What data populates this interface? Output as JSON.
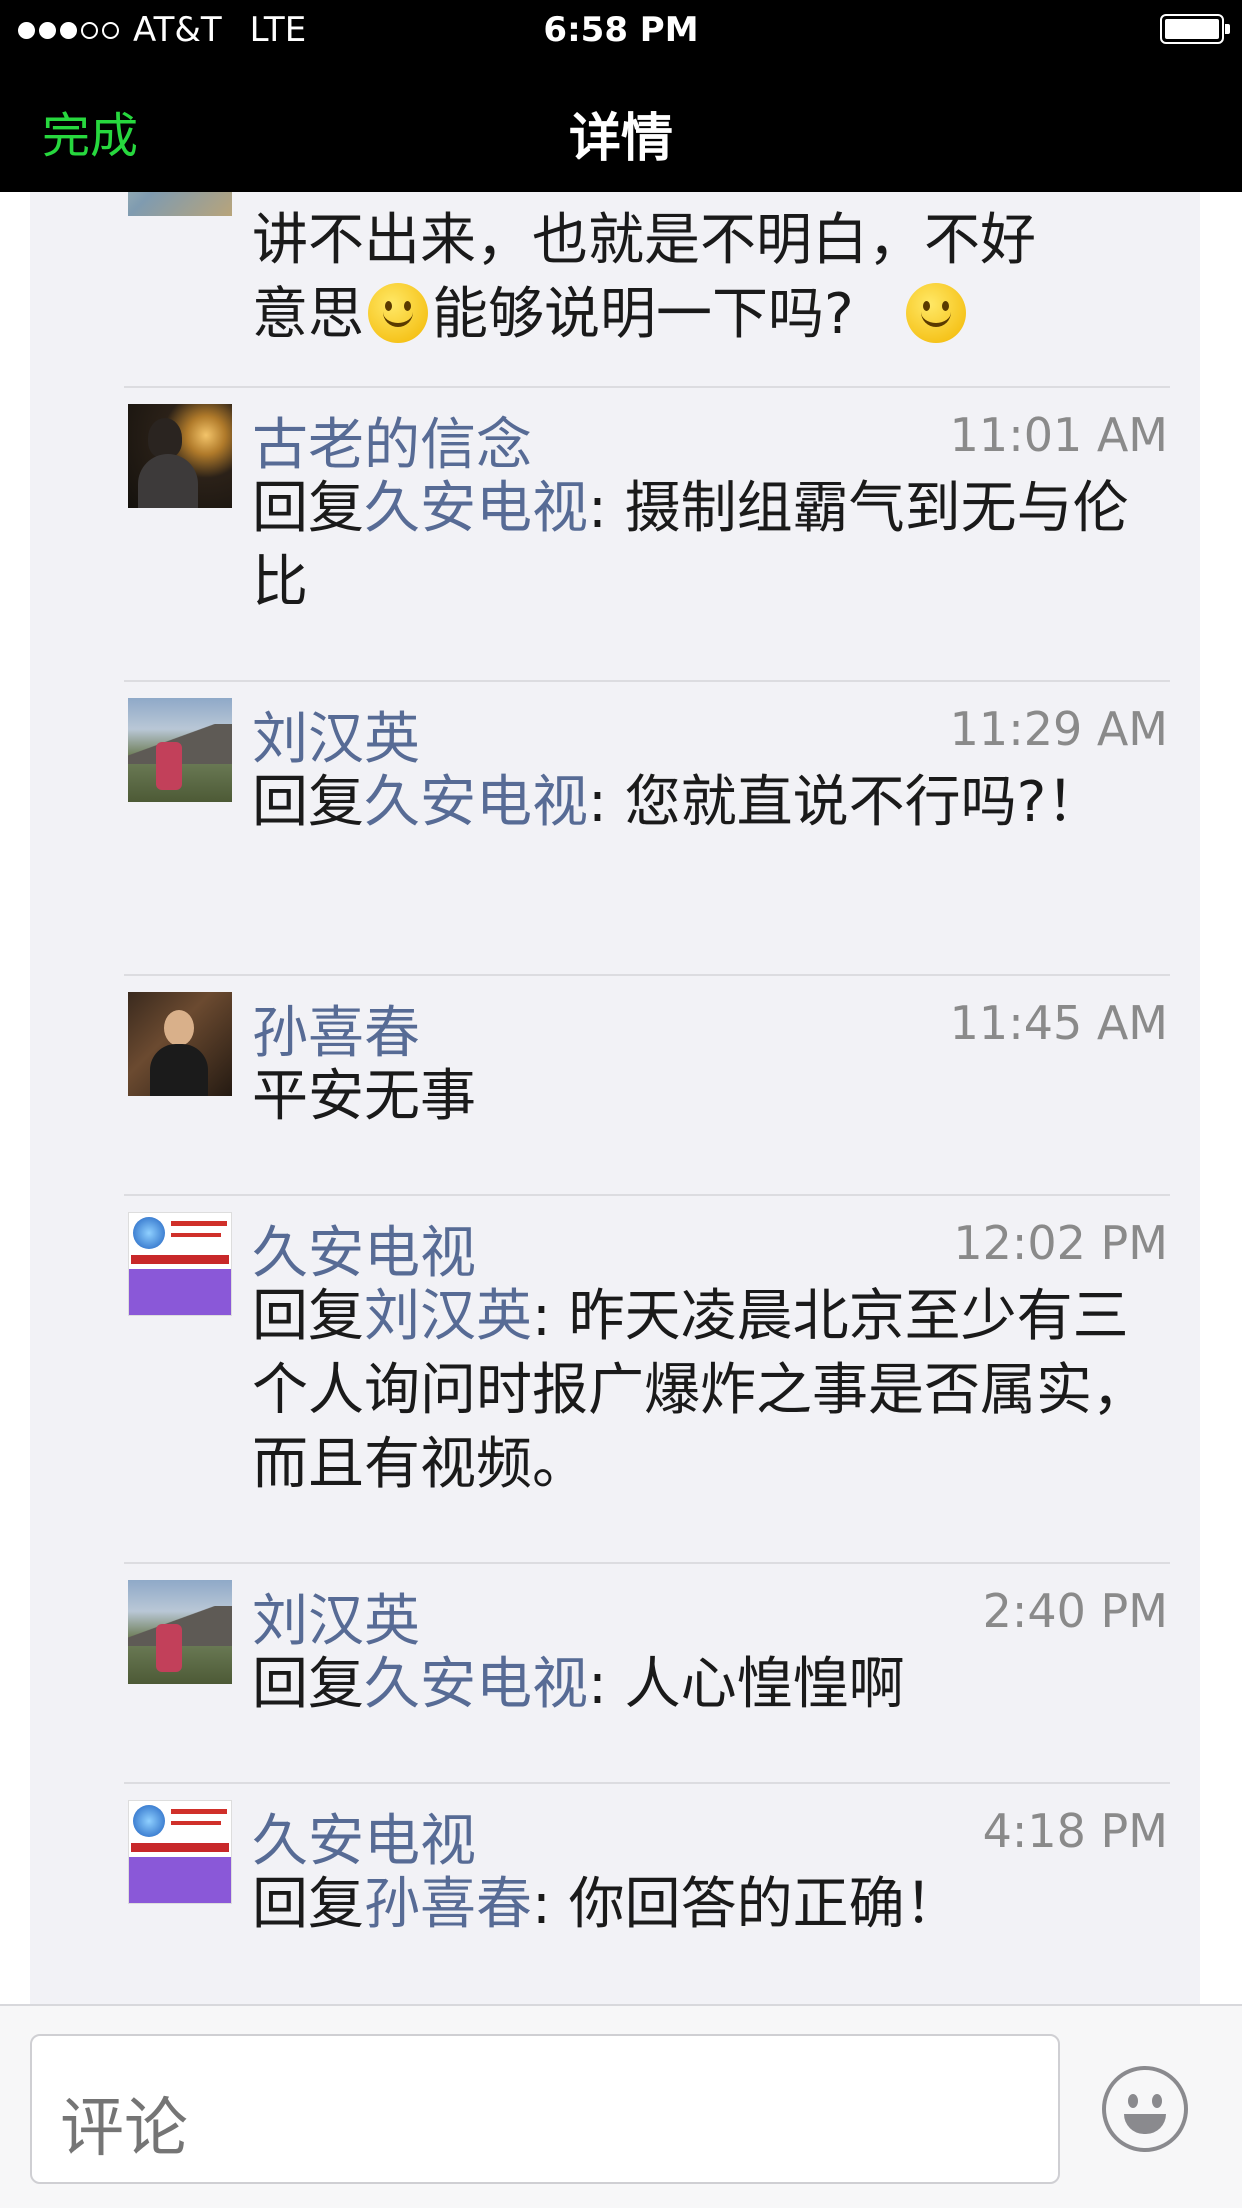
{
  "status_bar": {
    "signal_dots": [
      true,
      true,
      true,
      false,
      false
    ],
    "carrier": "AT&T",
    "network": "LTE",
    "time": "6:58 PM"
  },
  "nav": {
    "done_label": "完成",
    "title": "详情",
    "done_color": "#27d83e"
  },
  "partial_comment": {
    "text_line1": "讲不出来，也就是不明白，不好",
    "text_line2a": "意思",
    "text_line2b": "能够说明一下吗?"
  },
  "comments": [
    {
      "name": "古老的信念",
      "time": "11:01 AM",
      "reply_prefix": "回复",
      "reply_to": "久安电视",
      "text": ": 摄制组霸气到无与伦比",
      "avatar": "person-at-table-avatar"
    },
    {
      "name": "刘汉英",
      "time": "11:29 AM",
      "reply_prefix": "回复",
      "reply_to": "久安电视",
      "text": ": 您就直说不行吗?！",
      "avatar": "mountain-hiker-avatar"
    },
    {
      "name": "孙喜春",
      "time": "11:45 AM",
      "reply_prefix": "",
      "reply_to": "",
      "text": "平安无事",
      "avatar": "man-portrait-avatar"
    },
    {
      "name": "久安电视",
      "time": "12:02 PM",
      "reply_prefix": "回复",
      "reply_to": "刘汉英",
      "text": ": 昨天凌晨北京至少有三个人询问时报广爆炸之事是否属实，而且有视频。",
      "avatar": "company-logo-avatar"
    },
    {
      "name": "刘汉英",
      "time": "2:40 PM",
      "reply_prefix": "回复",
      "reply_to": "久安电视",
      "text": ": 人心惶惶啊",
      "avatar": "mountain-hiker-avatar"
    },
    {
      "name": "久安电视",
      "time": "4:18 PM",
      "reply_prefix": "回复",
      "reply_to": "孙喜春",
      "text": ": 你回答的正确！",
      "avatar": "company-logo-avatar"
    }
  ],
  "input": {
    "placeholder": "评论"
  },
  "colors": {
    "link_blue": "#576b95",
    "background": "#f2f2f6"
  }
}
